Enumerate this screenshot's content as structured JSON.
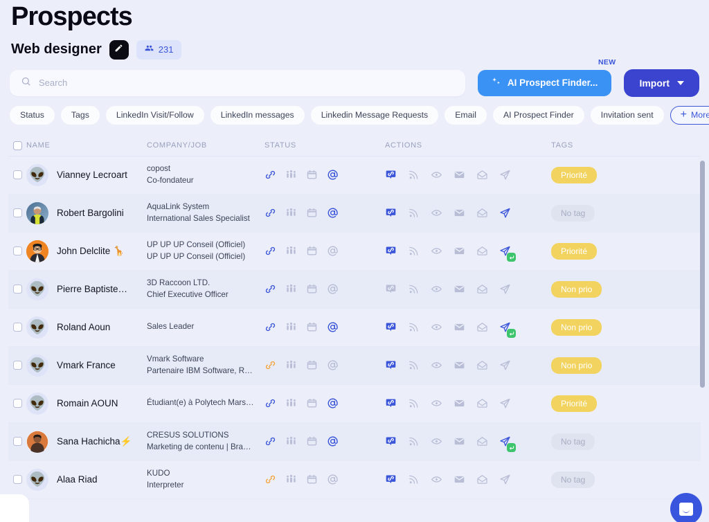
{
  "header": {
    "title": "Prospects",
    "subtitle": "Web designer",
    "edit_icon": "pen-icon",
    "count_icon": "people-icon",
    "count": "231"
  },
  "search": {
    "placeholder": "Search",
    "value": "",
    "icon": "search-icon"
  },
  "actions": {
    "ai_label": "AI Prospect Finder...",
    "ai_icon": "sparkles-icon",
    "new_badge": "NEW",
    "import_label": "Import",
    "import_chevron": "chevron-down-icon"
  },
  "filters": [
    {
      "label": "Status"
    },
    {
      "label": "Tags"
    },
    {
      "label": "LinkedIn Visit/Follow"
    },
    {
      "label": "LinkedIn messages"
    },
    {
      "label": "Linkedin Message Requests"
    },
    {
      "label": "Email"
    },
    {
      "label": "AI Prospect Finder"
    },
    {
      "label": "Invitation sent"
    }
  ],
  "more_filters": {
    "label": "More filters",
    "icon": "plus-icon"
  },
  "table": {
    "columns": {
      "name": "NAME",
      "company": "COMPANY/JOB",
      "status": "STATUS",
      "actions": "ACTIONS",
      "tags": "TAGS"
    },
    "rows": [
      {
        "name": "Vianney Lecroart",
        "avatar": "alien-avatar",
        "avatar_glyph": "👽",
        "company": "copost",
        "job": "Co-fondateur",
        "status": {
          "link": "active",
          "people": "inactive",
          "calendar": "inactive",
          "at": "active"
        },
        "act": {
          "link_badge": "active",
          "rss": "inactive",
          "eye": "inactive",
          "mail": "inactive",
          "mail_open": "inactive",
          "send": "inactive",
          "replied": false
        },
        "tag": "Priorité",
        "tag_state": "yellow"
      },
      {
        "name": "Robert Bargolini",
        "avatar": "photo-avatar",
        "avatar_glyph": "",
        "company": "AquaLink System",
        "job": "International Sales Specialist",
        "status": {
          "link": "active",
          "people": "inactive",
          "calendar": "inactive",
          "at": "active"
        },
        "act": {
          "link_badge": "active",
          "rss": "inactive",
          "eye": "inactive",
          "mail": "inactive",
          "mail_open": "inactive",
          "send": "active",
          "replied": false
        },
        "tag": "No tag",
        "tag_state": "none"
      },
      {
        "name": "John Delclite 🦒",
        "avatar": "photo-avatar",
        "avatar_glyph": "",
        "company": "UP UP UP Conseil (Officiel)",
        "job": "UP UP UP Conseil (Officiel)",
        "status": {
          "link": "active",
          "people": "inactive",
          "calendar": "inactive",
          "at": "inactive"
        },
        "act": {
          "link_badge": "active",
          "rss": "inactive",
          "eye": "inactive",
          "mail": "inactive",
          "mail_open": "inactive",
          "send": "active",
          "replied": true
        },
        "tag": "Priorité",
        "tag_state": "yellow"
      },
      {
        "name": "Pierre Baptiste…",
        "avatar": "alien-avatar",
        "avatar_glyph": "👽",
        "company": "3D Raccoon LTD.",
        "job": "Chief Executive Officer",
        "status": {
          "link": "active",
          "people": "inactive",
          "calendar": "inactive",
          "at": "inactive"
        },
        "act": {
          "link_badge": "disabled",
          "rss": "inactive",
          "eye": "inactive",
          "mail": "inactive",
          "mail_open": "inactive",
          "send": "inactive",
          "replied": false
        },
        "tag": "Non prio",
        "tag_state": "yellow"
      },
      {
        "name": "Roland Aoun",
        "avatar": "alien-avatar",
        "avatar_glyph": "👽",
        "company": "",
        "job": "Sales Leader",
        "status": {
          "link": "active",
          "people": "inactive",
          "calendar": "inactive",
          "at": "active"
        },
        "act": {
          "link_badge": "active",
          "rss": "inactive",
          "eye": "inactive",
          "mail": "inactive",
          "mail_open": "inactive",
          "send": "active",
          "replied": true
        },
        "tag": "Non prio",
        "tag_state": "yellow"
      },
      {
        "name": "Vmark France",
        "avatar": "alien-avatar",
        "avatar_glyph": "👽",
        "company": "Vmark Software",
        "job": "Partenaire IBM Software, R…",
        "status": {
          "link": "orange",
          "people": "inactive",
          "calendar": "inactive",
          "at": "inactive"
        },
        "act": {
          "link_badge": "active",
          "rss": "inactive",
          "eye": "inactive",
          "mail": "inactive",
          "mail_open": "inactive",
          "send": "inactive",
          "replied": false
        },
        "tag": "Non prio",
        "tag_state": "yellow"
      },
      {
        "name": "Romain AOUN",
        "avatar": "alien-avatar",
        "avatar_glyph": "👽",
        "company": "",
        "job": "Étudiant(e) à Polytech Mars…",
        "status": {
          "link": "active",
          "people": "inactive",
          "calendar": "inactive",
          "at": "active"
        },
        "act": {
          "link_badge": "active",
          "rss": "inactive",
          "eye": "inactive",
          "mail": "inactive",
          "mail_open": "inactive",
          "send": "inactive",
          "replied": false
        },
        "tag": "Priorité",
        "tag_state": "yellow"
      },
      {
        "name": "Sana Hachicha⚡",
        "avatar": "photo-avatar",
        "avatar_glyph": "",
        "company": "CRESUS SOLUTIONS",
        "job": "Marketing de contenu | Bra…",
        "status": {
          "link": "active",
          "people": "inactive",
          "calendar": "inactive",
          "at": "active"
        },
        "act": {
          "link_badge": "active",
          "rss": "inactive",
          "eye": "inactive",
          "mail": "inactive",
          "mail_open": "inactive",
          "send": "active",
          "replied": true
        },
        "tag": "No tag",
        "tag_state": "none"
      },
      {
        "name": "Alaa Riad",
        "avatar": "alien-avatar",
        "avatar_glyph": "👽",
        "company": "KUDO",
        "job": "Interpreter",
        "status": {
          "link": "orange",
          "people": "inactive",
          "calendar": "inactive",
          "at": "inactive"
        },
        "act": {
          "link_badge": "active",
          "rss": "inactive",
          "eye": "inactive",
          "mail": "inactive",
          "mail_open": "inactive",
          "send": "inactive",
          "replied": false
        },
        "tag": "No tag",
        "tag_state": "none"
      }
    ]
  },
  "colors": {
    "page_bg": "#eceffa",
    "accent_blue": "#3b55d9",
    "ai_blue": "#3b92f5",
    "import_blue": "#3a44cf",
    "tag_yellow": "#f3d35f",
    "link_orange": "#f5a33c",
    "icon_grey": "#b9bed6",
    "reply_green": "#3ec46d"
  },
  "chat_widget": {
    "icon": "chat-icon"
  }
}
